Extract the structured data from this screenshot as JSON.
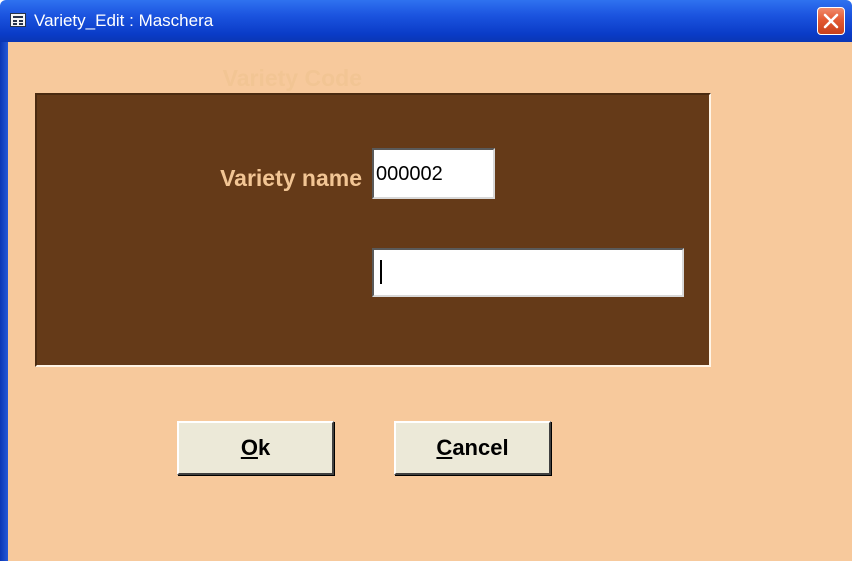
{
  "window": {
    "title": "Variety_Edit : Maschera",
    "icon": "form-icon",
    "close_icon": "close-icon"
  },
  "form": {
    "variety_code": {
      "label": "Variety Code",
      "value": "000002"
    },
    "variety_name": {
      "label": "Variety name",
      "value": ""
    }
  },
  "buttons": {
    "ok": {
      "accesskey": "O",
      "rest": "k"
    },
    "cancel": {
      "accesskey": "C",
      "rest": "ancel"
    }
  },
  "colors": {
    "title_bar": "#0a3cc8",
    "form_background": "#f7c99c",
    "panel_background": "#653a18",
    "label_text": "#f2c594",
    "button_face": "#ece9d8",
    "close_button": "#e35a33"
  }
}
